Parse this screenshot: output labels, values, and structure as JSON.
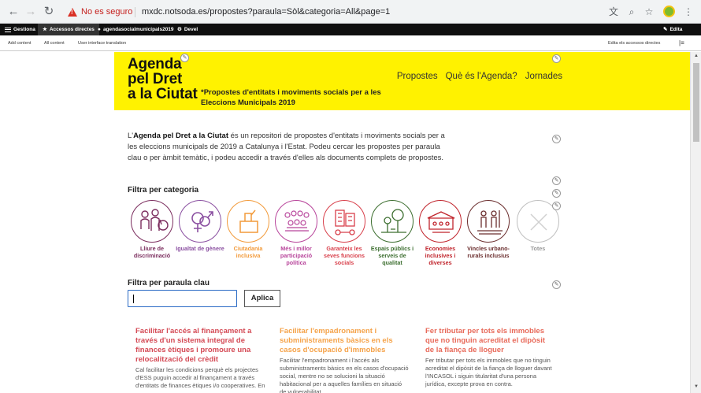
{
  "browser": {
    "security_warning": "No es seguro",
    "url": "mxdc.notsoda.es/propostes?paraula=Sòl&categoria=All&page=1"
  },
  "admin_bar": {
    "items": [
      "Gestiona",
      "Accessos directes",
      "agendasocialmunicipals2019",
      "Devel"
    ],
    "edit_label": "Edita"
  },
  "tray": {
    "items": [
      "Add content",
      "All content",
      "User interface translation"
    ],
    "edit_shortcuts": "Edita els accessos directes"
  },
  "header": {
    "logo": [
      "Agenda",
      "pel Dret",
      "a la Ciutat"
    ],
    "tagline": "*Propostes d'entitats i moviments socials per a les Eleccions Municipals 2019",
    "nav": [
      "Propostes",
      "Què és l'Agenda?",
      "Jornades"
    ]
  },
  "intro": {
    "prefix": "L'",
    "bold": "Agenda pel Dret a la Ciutat",
    "text": " és un repositori de propostes d'entitats i moviments socials per a les eleccions municipals de 2019 a Catalunya i l'Estat. Podeu cercar les propostes per paraula clau o per àmbit temàtic, i podeu accedir a través d'elles als documents complets de propostes."
  },
  "filters": {
    "category_title": "Filtra per categoria",
    "keyword_title": "Filtra per paraula clau",
    "apply": "Aplica",
    "search_value": ""
  },
  "categories": [
    {
      "label": "Lliure de discriminació",
      "color": "#7b2d5e",
      "icon": "people-wheelchair-icon"
    },
    {
      "label": "Igualtat de gènere",
      "color": "#8a4fa0",
      "icon": "gender-symbols-icon"
    },
    {
      "label": "Ciutadania inclusiva",
      "color": "#f29a3a",
      "icon": "ballot-box-icon"
    },
    {
      "label": "Més i millor participació política",
      "color": "#b8459b",
      "icon": "assembly-icon"
    },
    {
      "label": "Garanteix les seves funcions socials",
      "color": "#d83f4a",
      "icon": "buildings-icon"
    },
    {
      "label": "Espais públics i serveis de qualitat",
      "color": "#3c6e2f",
      "icon": "park-icon"
    },
    {
      "label": "Economies inclusives i diverses",
      "color": "#c0232b",
      "icon": "market-icon"
    },
    {
      "label": "Vincles urbano-rurals inclusius",
      "color": "#6b2e2e",
      "icon": "farmers-icon"
    },
    {
      "label": "Totes",
      "color": "#bfbfbf",
      "icon": "cross-icon"
    }
  ],
  "cards": [
    {
      "title": "Facilitar l'accés al finançament a través d'un sistema integral de finances ètiques i promoure una relocalització del crèdit",
      "body": "Cal facilitar les condicions perquè els projectes d'ESS puguin accedir al finançament a través d'entitats de finances ètiques i/o cooperatives. En",
      "color": "#d44a55"
    },
    {
      "title": "Facilitar l'empadronament i subministraments bàsics en els casos d'ocupació d'immobles",
      "body": "Facilitar l'empadronament i l'accés als subministraments bàsics en els casos d'ocupació social, mentre no se solucioni la situació habitacional per a aquelles famílies en situació de vulnerabilitat",
      "color": "#f5a34a"
    },
    {
      "title": "Fer tributar per tots els immobles que no tinguin acreditat el dipòsit de la fiança de lloguer",
      "body": "Fer tributar per tots els immobles que no tinguin acreditat el dipòsit de la fiança de lloguer davant l'INCASOL i siguin titularitat d'una persona jurídica, excepte prova en contra.",
      "color": "#e86a5a"
    }
  ]
}
